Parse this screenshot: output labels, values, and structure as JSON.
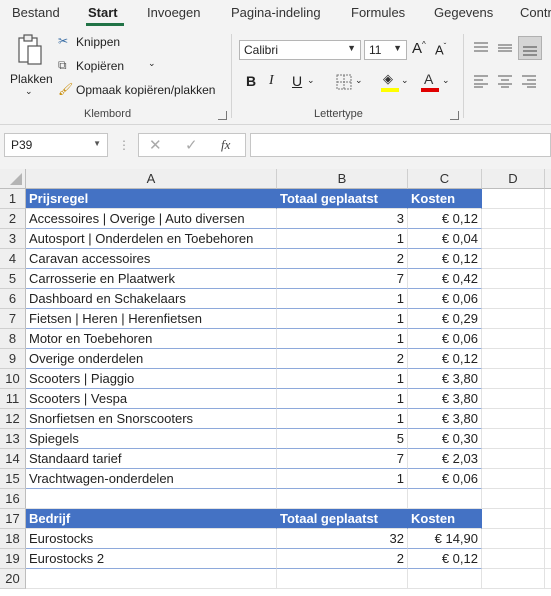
{
  "ribbon_tabs": [
    "Bestand",
    "Start",
    "Invoegen",
    "Pagina-indeling",
    "Formules",
    "Gegevens",
    "Contr"
  ],
  "clipboard": {
    "paste_label": "Plakken",
    "cut_label": "Knippen",
    "copy_label": "Kopiëren",
    "format_painter_label": "Opmaak kopiëren/plakken",
    "group_label": "Klembord"
  },
  "font": {
    "font_name": "Calibri",
    "font_size": "11",
    "bold": "B",
    "italic": "I",
    "underline": "U",
    "group_label": "Lettertype",
    "fill_color": "#ffff00",
    "font_color": "#e00000"
  },
  "formula_bar": {
    "name_box": "P39",
    "fx": "fx",
    "formula": ""
  },
  "columns": [
    "A",
    "B",
    "C",
    "D"
  ],
  "rows": [
    {
      "n": "1",
      "a": "Prijsregel",
      "b": "Totaal geplaatst",
      "c": "Kosten",
      "type": "header"
    },
    {
      "n": "2",
      "a": "Accessoires | Overige | Auto diversen",
      "b": "3",
      "c": "€ 0,12",
      "type": "data"
    },
    {
      "n": "3",
      "a": "Autosport | Onderdelen en Toebehoren",
      "b": "1",
      "c": "€ 0,04",
      "type": "data"
    },
    {
      "n": "4",
      "a": "Caravan accessoires",
      "b": "2",
      "c": "€ 0,12",
      "type": "data"
    },
    {
      "n": "5",
      "a": "Carrosserie en Plaatwerk",
      "b": "7",
      "c": "€ 0,42",
      "type": "data"
    },
    {
      "n": "6",
      "a": "Dashboard en Schakelaars",
      "b": "1",
      "c": "€ 0,06",
      "type": "data"
    },
    {
      "n": "7",
      "a": "Fietsen | Heren | Herenfietsen",
      "b": "1",
      "c": "€ 0,29",
      "type": "data"
    },
    {
      "n": "8",
      "a": "Motor en Toebehoren",
      "b": "1",
      "c": "€ 0,06",
      "type": "data"
    },
    {
      "n": "9",
      "a": "Overige onderdelen",
      "b": "2",
      "c": "€ 0,12",
      "type": "data"
    },
    {
      "n": "10",
      "a": "Scooters | Piaggio",
      "b": "1",
      "c": "€ 3,80",
      "type": "data"
    },
    {
      "n": "11",
      "a": "Scooters | Vespa",
      "b": "1",
      "c": "€ 3,80",
      "type": "data"
    },
    {
      "n": "12",
      "a": "Snorfietsen en Snorscooters",
      "b": "1",
      "c": "€ 3,80",
      "type": "data"
    },
    {
      "n": "13",
      "a": "Spiegels",
      "b": "5",
      "c": "€ 0,30",
      "type": "data"
    },
    {
      "n": "14",
      "a": "Standaard tarief",
      "b": "7",
      "c": "€ 2,03",
      "type": "data"
    },
    {
      "n": "15",
      "a": "Vrachtwagen-onderdelen",
      "b": "1",
      "c": "€ 0,06",
      "type": "data"
    },
    {
      "n": "16",
      "a": "",
      "b": "",
      "c": "",
      "type": "empty"
    },
    {
      "n": "17",
      "a": "Bedrijf",
      "b": "Totaal geplaatst",
      "c": "Kosten",
      "type": "header"
    },
    {
      "n": "18",
      "a": "Eurostocks",
      "b": "32",
      "c": "€ 14,90",
      "type": "data"
    },
    {
      "n": "19",
      "a": "Eurostocks 2",
      "b": "2",
      "c": "€ 0,12",
      "type": "data"
    },
    {
      "n": "20",
      "a": "",
      "b": "",
      "c": "",
      "type": "empty"
    }
  ]
}
